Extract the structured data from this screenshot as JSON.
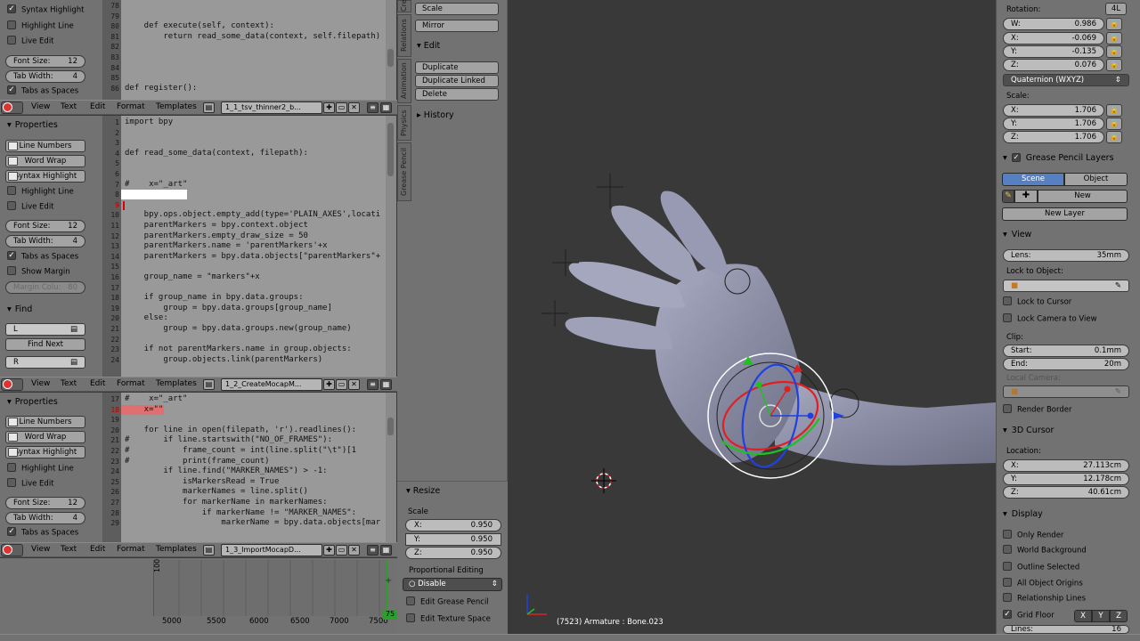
{
  "editors": [
    {
      "props": {
        "top_items": [
          {
            "type": "check",
            "label": "Syntax Highlight",
            "on": true
          },
          {
            "type": "check",
            "label": "Highlight Line",
            "on": false
          },
          {
            "type": "check",
            "label": "Live Edit",
            "on": false
          }
        ],
        "font_size": {
          "label": "Font Size:",
          "value": "12"
        },
        "tab_width": {
          "label": "Tab Width:",
          "value": "4"
        },
        "tabs_as_spaces": {
          "label": "Tabs as Spaces",
          "on": true
        }
      },
      "lines": [
        {
          "n": "78",
          "code": ""
        },
        {
          "n": "79",
          "code": ""
        },
        {
          "n": "80",
          "code": "    def execute(self, context):"
        },
        {
          "n": "81",
          "code": "        return read_some_data(context, self.filepath)"
        },
        {
          "n": "82",
          "code": ""
        },
        {
          "n": "83",
          "code": ""
        },
        {
          "n": "84",
          "code": ""
        },
        {
          "n": "85",
          "code": ""
        },
        {
          "n": "86",
          "code": "def register():"
        }
      ],
      "header": {
        "file": "1_1_tsv_thinner2_b..."
      }
    },
    {
      "props": {
        "title": "Properties",
        "buttons": [
          "Line Numbers",
          "Word Wrap",
          "Syntax Highlight"
        ],
        "checks": [
          {
            "label": "Highlight Line",
            "on": false
          },
          {
            "label": "Live Edit",
            "on": false
          }
        ],
        "font_size": {
          "label": "Font Size:",
          "value": "12"
        },
        "tab_width": {
          "label": "Tab Width:",
          "value": "4"
        },
        "tabs_as_spaces": {
          "label": "Tabs as Spaces",
          "on": true
        },
        "show_margin": {
          "label": "Show Margin",
          "on": false
        },
        "margin_col": {
          "label": "Margin Colu:",
          "value": "80"
        },
        "find_title": "Find",
        "find_value": "L",
        "find_next": "Find Next",
        "replace_value": "R"
      },
      "lines": [
        {
          "n": "1",
          "code": "import bpy"
        },
        {
          "n": "2",
          "code": ""
        },
        {
          "n": "3",
          "code": ""
        },
        {
          "n": "4",
          "code": "def read_some_data(context, filepath):"
        },
        {
          "n": "5",
          "code": ""
        },
        {
          "n": "6",
          "code": ""
        },
        {
          "n": "7",
          "code": "#    x=\"_art\""
        },
        {
          "n": "8",
          "code": ""
        },
        {
          "n": "9",
          "code": ""
        },
        {
          "n": "10",
          "code": "    bpy.ops.object.empty_add(type='PLAIN_AXES',locati"
        },
        {
          "n": "11",
          "code": "    parentMarkers = bpy.context.object"
        },
        {
          "n": "12",
          "code": "    parentMarkers.empty_draw_size = 50"
        },
        {
          "n": "13",
          "code": "    parentMarkers.name = 'parentMarkers'+x"
        },
        {
          "n": "14",
          "code": "    parentMarkers = bpy.data.objects[\"parentMarkers\"+"
        },
        {
          "n": "15",
          "code": ""
        },
        {
          "n": "16",
          "code": "    group_name = \"markers\"+x"
        },
        {
          "n": "17",
          "code": ""
        },
        {
          "n": "18",
          "code": "    if group_name in bpy.data.groups:"
        },
        {
          "n": "19",
          "code": "        group = bpy.data.groups[group_name]"
        },
        {
          "n": "20",
          "code": "    else:"
        },
        {
          "n": "21",
          "code": "        group = bpy.data.groups.new(group_name)"
        },
        {
          "n": "22",
          "code": ""
        },
        {
          "n": "23",
          "code": "    if not parentMarkers.name in group.objects:"
        },
        {
          "n": "24",
          "code": "        group.objects.link(parentMarkers)"
        }
      ],
      "header": {
        "file": "1_2_CreateMocapM..."
      }
    },
    {
      "props": {
        "title": "Properties",
        "buttons": [
          "Line Numbers",
          "Word Wrap",
          "Syntax Highlight"
        ],
        "checks": [
          {
            "label": "Highlight Line",
            "on": false
          },
          {
            "label": "Live Edit",
            "on": false
          }
        ],
        "font_size": {
          "label": "Font Size:",
          "value": "12"
        },
        "tab_width": {
          "label": "Tab Width:",
          "value": "4"
        },
        "tabs_as_spaces": {
          "label": "Tabs as Spaces",
          "on": true
        }
      },
      "lines": [
        {
          "n": "17",
          "code": "#    x=\"_art\""
        },
        {
          "n": "18",
          "code": "    x=\"\""
        },
        {
          "n": "19",
          "code": ""
        },
        {
          "n": "20",
          "code": "    for line in open(filepath, 'r').readlines():"
        },
        {
          "n": "21",
          "code": "#       if line.startswith(\"NO_OF_FRAMES\"):"
        },
        {
          "n": "22",
          "code": "#           frame_count = int(line.split(\"\\t\")[1"
        },
        {
          "n": "23",
          "code": "#           print(frame_count)"
        },
        {
          "n": "24",
          "code": "        if line.find(\"MARKER_NAMES\") > -1:"
        },
        {
          "n": "25",
          "code": "            isMarkersRead = True"
        },
        {
          "n": "26",
          "code": "            markerNames = line.split()"
        },
        {
          "n": "27",
          "code": "            for markerName in markerNames:"
        },
        {
          "n": "28",
          "code": "                if markerName != \"MARKER_NAMES\":"
        },
        {
          "n": "29",
          "code": "                    markerName = bpy.data.objects[mar"
        }
      ],
      "header": {
        "file": "1_3_ImportMocapD..."
      }
    }
  ],
  "header_menu": [
    "View",
    "Text",
    "Edit",
    "Format",
    "Templates"
  ],
  "timeline": {
    "ticks": [
      "5000",
      "5500",
      "6000",
      "6500",
      "7000",
      "7500"
    ],
    "y_label": "100",
    "frame_badge": "75"
  },
  "shelf": {
    "top_buttons": [
      "Scale",
      "Mirror"
    ],
    "edit_title": "Edit",
    "edit_buttons": [
      "Duplicate",
      "Duplicate Linked",
      "Delete"
    ],
    "history_title": "History",
    "tabs": [
      "Create",
      "Relations",
      "Animation",
      "Physics",
      "Grease Pencil"
    ],
    "resize": {
      "title": "Resize",
      "scale_label": "Scale",
      "fields": [
        {
          "axis": "X:",
          "value": "0.950"
        },
        {
          "axis": "Y:",
          "value": "0.950"
        },
        {
          "axis": "Z:",
          "value": "0.950"
        }
      ],
      "prop_edit_label": "Proportional Editing",
      "prop_edit_value": "Disable",
      "checks": [
        "Edit Grease Pencil",
        "Edit Texture Space"
      ]
    }
  },
  "viewport": {
    "status": "(7523) Armature : Bone.023"
  },
  "n_panel": {
    "rotation_label": "Rotation:",
    "rotation_mode_btn": "4L",
    "rotation": [
      {
        "axis": "W:",
        "value": "0.986"
      },
      {
        "axis": "X:",
        "value": "-0.069"
      },
      {
        "axis": "Y:",
        "value": "-0.135"
      },
      {
        "axis": "Z:",
        "value": "0.076"
      }
    ],
    "rotation_mode": "Quaternion (WXYZ)",
    "scale_label": "Scale:",
    "scale": [
      {
        "axis": "X:",
        "value": "1.706"
      },
      {
        "axis": "Y:",
        "value": "1.706"
      },
      {
        "axis": "Z:",
        "value": "1.706"
      }
    ],
    "gp_layers": {
      "title": "Grease Pencil Layers",
      "scene": "Scene",
      "object": "Object",
      "new": "New",
      "new_layer": "New Layer"
    },
    "view": {
      "title": "View",
      "lens_label": "Lens:",
      "lens_value": "35mm",
      "lock_obj_label": "Lock to Object:",
      "lock_cursor": "Lock to Cursor",
      "lock_camera": "Lock Camera to View",
      "clip_label": "Clip:",
      "clip_start_label": "Start:",
      "clip_start": "0.1mm",
      "clip_end_label": "End:",
      "clip_end": "20m",
      "local_camera": "Local Camera:",
      "render_border": "Render Border"
    },
    "cursor": {
      "title": "3D Cursor",
      "location_label": "Location:",
      "loc": [
        {
          "axis": "X:",
          "value": "27.113cm"
        },
        {
          "axis": "Y:",
          "value": "12.178cm"
        },
        {
          "axis": "Z:",
          "value": "40.61cm"
        }
      ]
    },
    "display": {
      "title": "Display",
      "checks": [
        "Only Render",
        "World Background",
        "Outline Selected",
        "All Object Origins",
        "Relationship Lines"
      ],
      "grid_floor": "Grid Floor",
      "axes": [
        "X",
        "Y",
        "Z"
      ],
      "lines_label": "Lines:",
      "lines_value": "16"
    }
  },
  "colors": {
    "accent": "#5680c2",
    "x_axis": "#e02020",
    "y_axis": "#20c020",
    "z_axis": "#2040e0"
  }
}
